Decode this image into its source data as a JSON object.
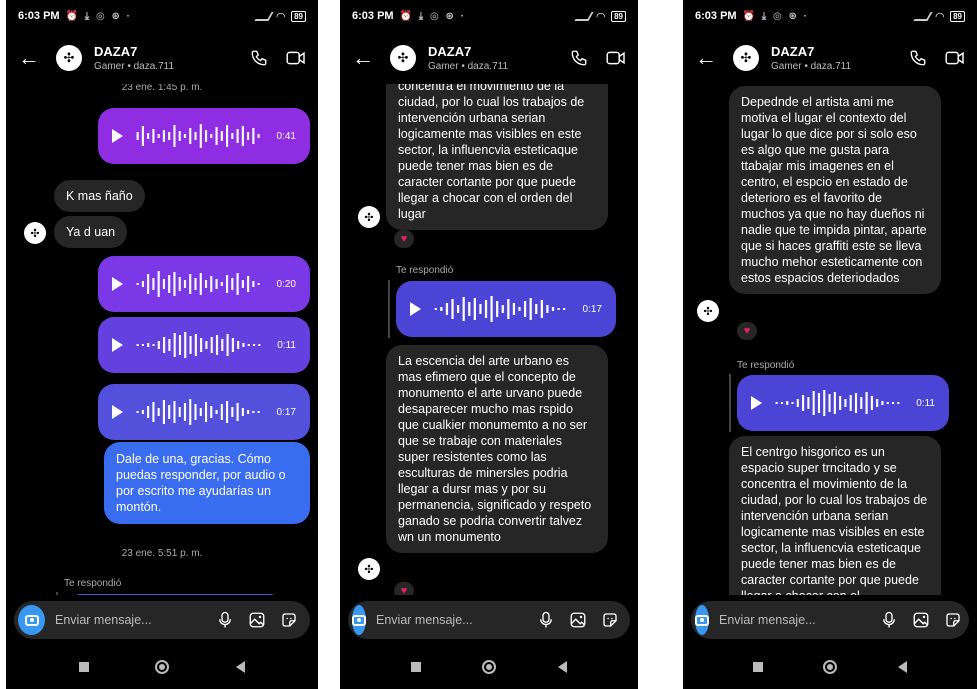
{
  "status": {
    "time": "6:03 PM",
    "battery": "89"
  },
  "contact": {
    "name": "DAZA7",
    "subtitle": "Gamer • daza.711",
    "avatar_glyph": "✣"
  },
  "composer": {
    "placeholder": "Enviar mensaje..."
  },
  "colors": {
    "voice_purple": "#8e2de2",
    "voice_violet": "#6a3de8",
    "voice_indigo": "#4b44d4",
    "voice_blue": "#4060e0",
    "text_blue": "#3a6cf0",
    "incoming": "#262626"
  },
  "screen1": {
    "ts1": "23 ene. 1:45 p. m.",
    "voice1_dur": "0:41",
    "in1": "K mas ñaño",
    "in2": "Ya d uan",
    "voice2_dur": "0:20",
    "voice3_dur": "0:11",
    "voice4_dur": "0:17",
    "out_text": "Dale de una, gracias. Cómo puedas responder, por audio o por escrito me ayudarías un montón.",
    "ts2": "23 ene. 5:51 p. m.",
    "replied": "Te respondió"
  },
  "screen2": {
    "msg1": "concentra el movimiento de la ciudad, por lo cual los trabajos de intervención urbana serian logicamente mas visibles en este sector, la influencvia esteticaque puede tener mas bien es de caracter cortante por que puede llegar a chocar con el orden del lugar",
    "replied": "Te respondió",
    "voice_dur": "0:17",
    "msg2": "La escencia del arte urbano es mas efimero que el concepto de monumento el arte urvano puede desaparecer mucho mas rspido que cualkier monumemto a no ser que se trabaje con materiales super resistentes como las esculturas de minersles podria llegar a dursr mas y por su permanencia, significado y respeto ganado se podria convertir talvez wn un monumento"
  },
  "screen3": {
    "msg1": "Depednde el artista ami me motiva el lugar el contexto del lugar lo que dice por si solo eso es algo que me gusta para ttabajar mis imagenes en el centro, el espcio en estado de deterioro es el favorito de muchos ya que no hay dueños ni nadie que te impida pintar, aparte que si haces graffiti este  se lleva mucho mehor esteticamente con estos espacios deteriodados",
    "replied": "Te respondió",
    "voice_dur": "0:11",
    "msg2": "El centrgo hisgorico es un espacio super trncitado y se concentra el movimiento de la ciudad, por lo cual los trabajos de intervención urbana serian logicamente mas visibles en este sector, la influencvia esteticaque puede tener mas bien es de caracter cortante por que puede llegar a chocar con el"
  }
}
